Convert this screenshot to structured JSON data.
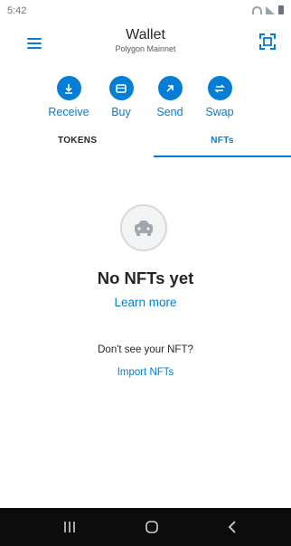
{
  "status_bar": {
    "time": "5:42"
  },
  "header": {
    "title": "Wallet",
    "network": "Polygon Mainnet"
  },
  "actions": [
    {
      "label": "Receive",
      "icon": "download-icon"
    },
    {
      "label": "Buy",
      "icon": "card-icon"
    },
    {
      "label": "Send",
      "icon": "arrow-up-right-icon"
    },
    {
      "label": "Swap",
      "icon": "swap-icon"
    }
  ],
  "tabs": {
    "tokens": "TOKENS",
    "nfts": "NFTs",
    "active": "NFTs"
  },
  "empty_state": {
    "title": "No NFTs yet",
    "learn_more": "Learn more",
    "hint": "Don't see your NFT?",
    "import": "Import NFTs"
  },
  "colors": {
    "accent": "#037dd6",
    "text": "#24272a",
    "nav_bar": "#0c0c0c"
  }
}
